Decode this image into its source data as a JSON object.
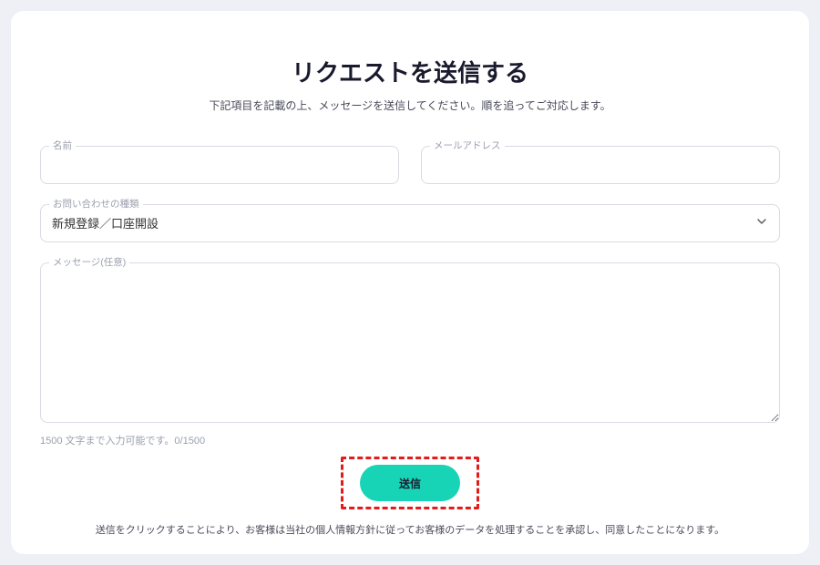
{
  "title": "リクエストを送信する",
  "subtitle": "下記項目を記載の上、メッセージを送信してください。順を追ってご対応します。",
  "fields": {
    "name_label": "名前",
    "email_label": "メールアドレス",
    "inquiry_label": "お問い合わせの種類",
    "inquiry_value": "新規登録／口座開設",
    "message_label": "メッセージ(任意)"
  },
  "counter_text": "1500 文字まで入力可能です。0/1500",
  "submit_label": "送信",
  "consent_text": "送信をクリックすることにより、お客様は当社の個人情報方針に従ってお客様のデータを処理することを承認し、同意したことになります。",
  "colors": {
    "accent": "#17d4b6",
    "highlight_border": "#e31b1b"
  }
}
